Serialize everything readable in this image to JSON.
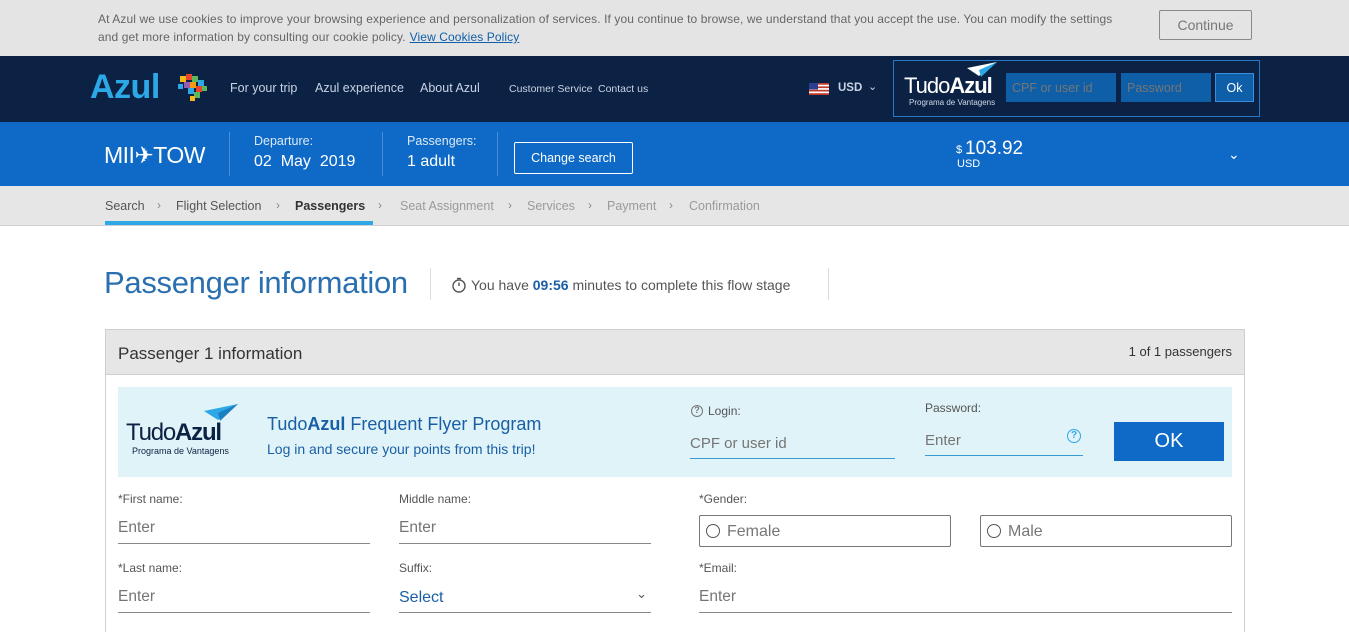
{
  "cookie": {
    "text": "At Azul we use cookies to improve your browsing experience and personalization of services. If you continue to browse, we understand that you accept the use. You can modify the settings and get more information by consulting our cookie policy.",
    "link": "View Cookies Policy",
    "continue": "Continue"
  },
  "header": {
    "logo": "Azul",
    "nav": [
      "For your trip",
      "Azul experience",
      "About Azul"
    ],
    "nav_small": [
      "Customer Service",
      "Contact us"
    ],
    "currency": "USD",
    "tudo_light": "Tudo",
    "tudo_bold": "Azul",
    "tudo_sub": "Programa de Vantagens",
    "user_placeholder": "CPF or user id",
    "password_placeholder": "Password",
    "ok": "Ok"
  },
  "summary": {
    "route": "MII✈TOW",
    "departure_label": "Departure:",
    "departure_day": "02",
    "departure_month": "May",
    "departure_year": "2019",
    "passengers_label": "Passengers:",
    "passengers_value": "1 adult",
    "change_search": "Change search",
    "price_symbol": "$",
    "price": "103.92",
    "price_currency": "USD"
  },
  "steps": [
    "Search",
    "Flight Selection",
    "Passengers",
    "Seat Assignment",
    "Services",
    "Payment",
    "Confirmation"
  ],
  "page": {
    "title": "Passenger information",
    "timer_prefix": "You have",
    "timer_value": "09:56",
    "timer_suffix": "minutes to complete this flow stage"
  },
  "panel": {
    "title": "Passenger 1 information",
    "count": "1 of 1 passengers",
    "ff_title_pre": "Tudo",
    "ff_title_bold": "Azul",
    "ff_title_post": " Frequent Flyer Program",
    "ff_sub": "Log in and secure your points from this trip!",
    "login_label": "Login:",
    "login_placeholder": "CPF or user id",
    "password_label": "Password:",
    "password_placeholder": "Enter",
    "ok": "OK"
  },
  "form": {
    "first_name_label": "*First name:",
    "middle_name_label": "Middle name:",
    "gender_label": "*Gender:",
    "female": "Female",
    "male": "Male",
    "last_name_label": "*Last name:",
    "suffix_label": "Suffix:",
    "suffix_value": "Select",
    "email_label": "*Email:",
    "placeholder": "Enter"
  },
  "colors": {
    "header_bg": "#0b2245",
    "summary_bg": "#0e6ac6",
    "accent": "#2da8e6",
    "title_blue": "#2a6fb0"
  }
}
